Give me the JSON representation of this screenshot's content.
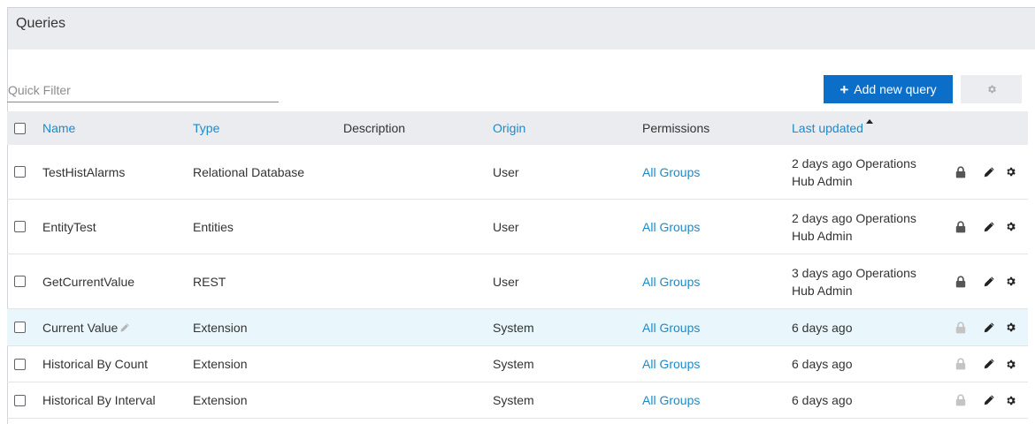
{
  "page": {
    "title": "Queries"
  },
  "filter": {
    "placeholder": "Quick Filter",
    "value": ""
  },
  "toolbar": {
    "add_label": "Add new query",
    "add_icon": "plus-icon",
    "settings_icon": "gear-icon"
  },
  "table": {
    "columns": {
      "name": "Name",
      "type": "Type",
      "description": "Description",
      "origin": "Origin",
      "permissions": "Permissions",
      "last_updated": "Last updated"
    },
    "sort": {
      "column": "last_updated",
      "direction": "ascending",
      "icon": "sort-up-caret-icon"
    },
    "rows": [
      {
        "name": "TestHistAlarms",
        "type": "Relational Database",
        "description": "",
        "origin": "User",
        "permissions": "All Groups",
        "updated": "2 days ago Operations Hub Admin",
        "checked": false,
        "lock_style": "dark",
        "name_icon": ""
      },
      {
        "name": "EntityTest",
        "type": "Entities",
        "description": "",
        "origin": "User",
        "permissions": "All Groups",
        "updated": "2 days ago Operations Hub Admin",
        "checked": false,
        "lock_style": "dark",
        "name_icon": ""
      },
      {
        "name": "GetCurrentValue",
        "type": "REST",
        "description": "",
        "origin": "User",
        "permissions": "All Groups",
        "updated": "3 days ago Operations Hub Admin",
        "checked": false,
        "lock_style": "dark",
        "name_icon": ""
      },
      {
        "name": "Current Value",
        "type": "Extension",
        "description": "",
        "origin": "System",
        "permissions": "All Groups",
        "updated": "6 days ago",
        "checked": false,
        "lock_style": "light",
        "name_icon": "pencil-icon"
      },
      {
        "name": "Historical By Count",
        "type": "Extension",
        "description": "",
        "origin": "System",
        "permissions": "All Groups",
        "updated": "6 days ago",
        "checked": false,
        "lock_style": "light",
        "name_icon": ""
      },
      {
        "name": "Historical By Interval",
        "type": "Extension",
        "description": "",
        "origin": "System",
        "permissions": "All Groups",
        "updated": "6 days ago",
        "checked": false,
        "lock_style": "light",
        "name_icon": ""
      }
    ],
    "selected_row": "Current Value"
  },
  "colors": {
    "accent": "#0b6fc9",
    "link": "#1a8bc9",
    "header_bg": "#ebecf0",
    "selected_row_bg": "#e9f7fc",
    "lock_dark": "#555555",
    "lock_light": "#c4c4c4"
  }
}
